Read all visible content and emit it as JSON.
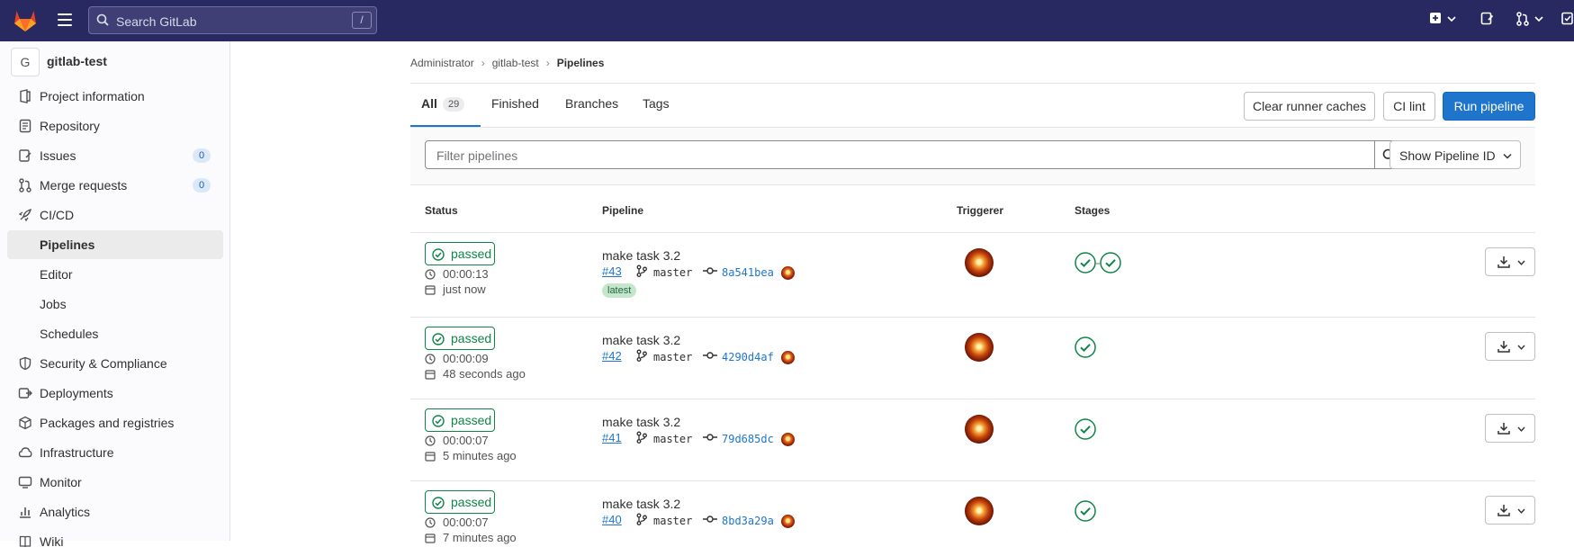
{
  "topbar": {
    "search_placeholder": "Search GitLab",
    "search_shortcut": "/",
    "brand_color": "#292961",
    "icons": [
      "gitlab-logo-icon",
      "hamburger-menu-icon",
      "search-icon",
      "plus-square-icon",
      "chevron-down-icon",
      "issues-icon",
      "merge-requests-icon",
      "todo-icon"
    ]
  },
  "sidebar": {
    "project_initial": "G",
    "project_name": "gitlab-test",
    "items": [
      {
        "label": "Project information",
        "icon": "project-info-icon"
      },
      {
        "label": "Repository",
        "icon": "doc-text-icon"
      },
      {
        "label": "Issues",
        "icon": "issues-icon",
        "badge": "0"
      },
      {
        "label": "Merge requests",
        "icon": "git-merge-icon",
        "badge": "0"
      },
      {
        "label": "CI/CD",
        "icon": "rocket-icon"
      }
    ],
    "cicd_sub": [
      {
        "label": "Pipelines",
        "active": true
      },
      {
        "label": "Editor"
      },
      {
        "label": "Jobs"
      },
      {
        "label": "Schedules"
      }
    ],
    "items_after": [
      {
        "label": "Security & Compliance",
        "icon": "shield-icon"
      },
      {
        "label": "Deployments",
        "icon": "deployments-icon"
      },
      {
        "label": "Packages and registries",
        "icon": "package-icon"
      },
      {
        "label": "Infrastructure",
        "icon": "cloud-icon"
      },
      {
        "label": "Monitor",
        "icon": "monitor-icon"
      },
      {
        "label": "Analytics",
        "icon": "chart-icon"
      },
      {
        "label": "Wiki",
        "icon": "book-icon"
      }
    ]
  },
  "breadcrumb": [
    "Administrator",
    "gitlab-test",
    "Pipelines"
  ],
  "tabs": [
    {
      "label": "All",
      "count": "29",
      "active": true
    },
    {
      "label": "Finished"
    },
    {
      "label": "Branches"
    },
    {
      "label": "Tags"
    }
  ],
  "actions": {
    "clear_caches": "Clear runner caches",
    "ci_lint": "CI lint",
    "run_pipeline": "Run pipeline",
    "primary_color": "#1f75cb"
  },
  "filter": {
    "placeholder": "Filter pipelines",
    "dropdown_value": "Show Pipeline ID"
  },
  "table": {
    "headers": [
      "Status",
      "Pipeline",
      "Triggerer",
      "Stages"
    ],
    "rows": [
      {
        "status": "passed",
        "duration": "00:00:13",
        "finished": "just now",
        "title": "make task 3.2",
        "id": "#43",
        "branch": "master",
        "sha": "8a541bea",
        "latest": "latest",
        "stages": 2
      },
      {
        "status": "passed",
        "duration": "00:00:09",
        "finished": "48 seconds ago",
        "title": "make task 3.2",
        "id": "#42",
        "branch": "master",
        "sha": "4290d4af",
        "stages": 1
      },
      {
        "status": "passed",
        "duration": "00:00:07",
        "finished": "5 minutes ago",
        "title": "make task 3.2",
        "id": "#41",
        "branch": "master",
        "sha": "79d685dc",
        "stages": 1
      },
      {
        "status": "passed",
        "duration": "00:00:07",
        "finished": "7 minutes ago",
        "title": "make task 3.2",
        "id": "#40",
        "branch": "master",
        "sha": "8bd3a29a",
        "stages": 1
      }
    ],
    "status_color": "#108548"
  }
}
